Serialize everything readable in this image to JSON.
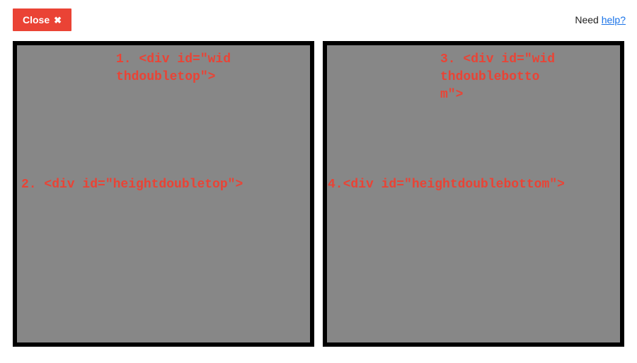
{
  "topbar": {
    "close_label": "Close",
    "need_label": "Need ",
    "help_label": "help?"
  },
  "panels": {
    "left": {
      "snippet1": "1. <div id=\"widthdoubletop\">",
      "snippet2": "2. <div id=\"heightdoubletop\">"
    },
    "right": {
      "snippet1": "3. <div id=\"widthdoublebottom\">",
      "snippet2": "4.<div id=\"heightdoublebottom\">"
    }
  }
}
